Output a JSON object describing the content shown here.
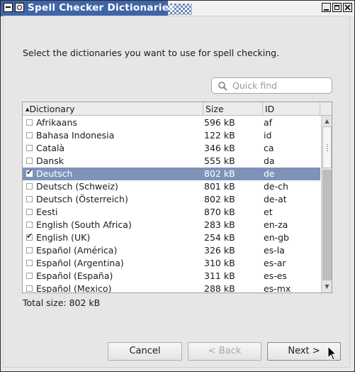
{
  "window": {
    "title": "Spell Checker Dictionaries",
    "accent_color": "#3f65a8",
    "controls": [
      "window-menu-icon",
      "shade-icon",
      "minimize-icon",
      "maximize-icon",
      "close-icon"
    ]
  },
  "instructions": "Select the dictionaries you want to use for spell checking.",
  "search": {
    "placeholder": "Quick find",
    "value": "",
    "icon": "search-icon"
  },
  "table": {
    "columns": [
      "Dictionary",
      "Size",
      "ID"
    ],
    "sort_column": "Dictionary",
    "sort_direction": "ascending",
    "selection_color": "#7f93b8",
    "rows": [
      {
        "name": "Afrikaans",
        "size": "596 kB",
        "id": "af",
        "checked": false,
        "selected": false
      },
      {
        "name": "Bahasa Indonesia",
        "size": "122 kB",
        "id": "id",
        "checked": false,
        "selected": false
      },
      {
        "name": "Català",
        "size": "346 kB",
        "id": "ca",
        "checked": false,
        "selected": false
      },
      {
        "name": "Dansk",
        "size": "555 kB",
        "id": "da",
        "checked": false,
        "selected": false
      },
      {
        "name": "Deutsch",
        "size": "802 kB",
        "id": "de",
        "checked": true,
        "selected": true
      },
      {
        "name": "Deutsch (Schweiz)",
        "size": "801 kB",
        "id": "de-ch",
        "checked": false,
        "selected": false
      },
      {
        "name": "Deutsch (Österreich)",
        "size": "802 kB",
        "id": "de-at",
        "checked": false,
        "selected": false
      },
      {
        "name": "Eesti",
        "size": "870 kB",
        "id": "et",
        "checked": false,
        "selected": false
      },
      {
        "name": "English (South Africa)",
        "size": "283 kB",
        "id": "en-za",
        "checked": false,
        "selected": false
      },
      {
        "name": "English (UK)",
        "size": "254 kB",
        "id": "en-gb",
        "checked": true,
        "selected": false
      },
      {
        "name": "Español (América)",
        "size": "326 kB",
        "id": "es-la",
        "checked": false,
        "selected": false
      },
      {
        "name": "Español (Argentina)",
        "size": "310 kB",
        "id": "es-ar",
        "checked": false,
        "selected": false
      },
      {
        "name": "Español (España)",
        "size": "311 kB",
        "id": "es-es",
        "checked": false,
        "selected": false
      },
      {
        "name": "Español (Mexico)",
        "size": "288 kB",
        "id": "es-mx",
        "checked": false,
        "selected": false
      }
    ]
  },
  "total_size": "Total size: 802 kB",
  "buttons": {
    "cancel": "Cancel",
    "back": "< Back",
    "next": "Next >"
  }
}
